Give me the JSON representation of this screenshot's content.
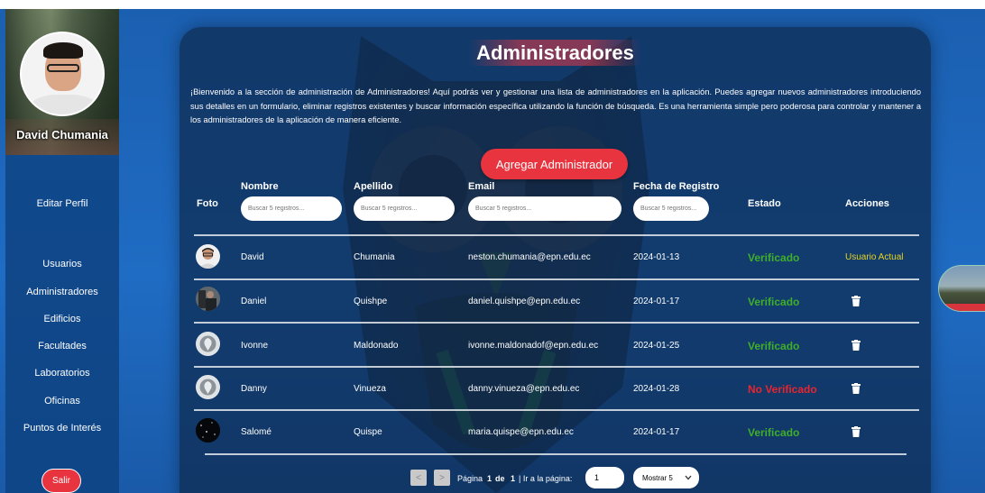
{
  "sidebar": {
    "user_name": "David Chumania",
    "edit_profile": "Editar Perfil",
    "items": [
      {
        "label": "Usuarios"
      },
      {
        "label": "Administradores"
      },
      {
        "label": "Edificios"
      },
      {
        "label": "Facultades"
      },
      {
        "label": "Laboratorios"
      },
      {
        "label": "Oficinas"
      },
      {
        "label": "Puntos de Interés"
      }
    ],
    "logout": "Salir"
  },
  "main": {
    "title": "Administradores",
    "intro": "¡Bienvenido a la sección de administración de Administradores! Aquí podrás ver y gestionar una lista de administradores en la aplicación. Puedes agregar nuevos administradores introduciendo sus detalles en un formulario, eliminar registros existentes y buscar información específica utilizando la función de búsqueda. Es una herramienta simple pero poderosa para controlar y mantener a los administradores de la aplicación de manera eficiente.",
    "add_button": "Agregar Administrador"
  },
  "table": {
    "headers": {
      "photo": "Foto",
      "name": "Nombre",
      "lastname": "Apellido",
      "email": "Email",
      "date": "Fecha de Registro",
      "status": "Estado",
      "actions": "Acciones"
    },
    "filter_placeholder": "Buscar 5 registros...",
    "rows": [
      {
        "name": "David",
        "lastname": "Chumania",
        "email": "neston.chumania@epn.edu.ec",
        "date": "2024-01-13",
        "status": "Verificado",
        "action": "Usuario Actual",
        "avatar": "person"
      },
      {
        "name": "Daniel",
        "lastname": "Quishpe",
        "email": "daniel.quishpe@epn.edu.ec",
        "date": "2024-01-17",
        "status": "Verificado",
        "action": "trash-icon",
        "avatar": "photo"
      },
      {
        "name": "Ivonne",
        "lastname": "Maldonado",
        "email": "ivonne.maldonadof@epn.edu.ec",
        "date": "2024-01-25",
        "status": "Verificado",
        "action": "trash-icon",
        "avatar": "default"
      },
      {
        "name": "Danny",
        "lastname": "Vinueza",
        "email": "danny.vinueza@epn.edu.ec",
        "date": "2024-01-28",
        "status": "No Verificado",
        "action": "trash-icon",
        "avatar": "default"
      },
      {
        "name": "Salomé",
        "lastname": "Quispe",
        "email": "maria.quispe@epn.edu.ec",
        "date": "2024-01-17",
        "status": "Verificado",
        "action": "trash-icon",
        "avatar": "stars"
      }
    ]
  },
  "pagination": {
    "prev": "<",
    "next": ">",
    "page_label": "Página",
    "page_current": "1",
    "page_of": "de",
    "page_total": "1",
    "goto_label": "| Ir a la página:",
    "goto_value": "1",
    "show_select": "Mostrar 5"
  },
  "colors": {
    "accent": "#e8343f",
    "verified": "#3fae2a",
    "not_verified": "#e8252f",
    "current_user": "#e6d321"
  }
}
